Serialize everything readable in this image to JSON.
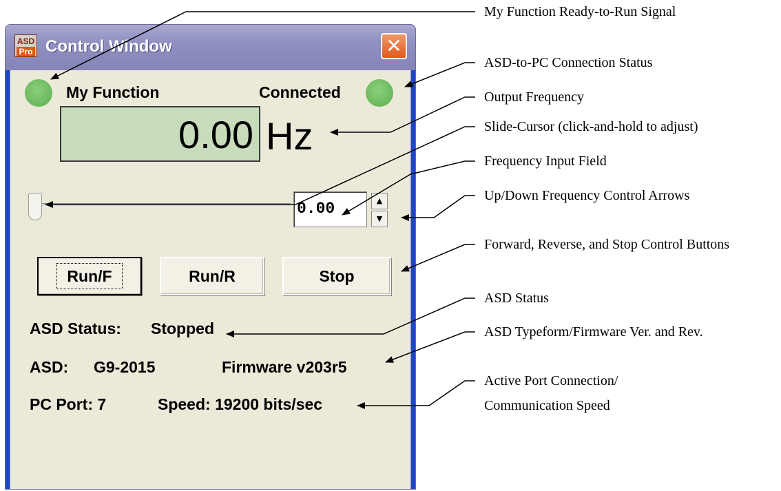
{
  "window": {
    "title": "Control Window",
    "app_icon_text": [
      "ASD",
      "Pro"
    ],
    "close_glyph": "✕"
  },
  "indicators": {
    "my_function_label": "My Function",
    "connected_label": "Connected",
    "led_color": "#6ab85c"
  },
  "frequency": {
    "display_value": "0.00",
    "unit": "Hz",
    "input_value": "0.00",
    "slider_value": 0.0
  },
  "buttons": {
    "run_forward": "Run/F",
    "run_reverse": "Run/R",
    "stop": "Stop"
  },
  "status": {
    "asd_status_label": "ASD Status:",
    "asd_status_value": "Stopped",
    "asd_label": "ASD:",
    "asd_value": "G9-2015",
    "firmware": "Firmware v203r5",
    "pc_port": "PC Port: 7",
    "speed": "Speed: 19200 bits/sec"
  },
  "icons": {
    "close": "close-icon",
    "spin_up": "arrow-up-icon",
    "spin_down": "arrow-down-icon"
  },
  "callouts": {
    "ready_signal": "My Function Ready-to-Run Signal",
    "connection_status": "ASD-to-PC Connection Status",
    "output_frequency": "Output Frequency",
    "slide_cursor": "Slide-Cursor (click-and-hold to adjust)",
    "frequency_input": "Frequency Input Field",
    "updown_arrows": "Up/Down Frequency Control Arrows",
    "control_buttons": "Forward, Reverse, and Stop Control Buttons",
    "asd_status": "ASD Status",
    "typeform": "ASD Typeform/Firmware Ver. and Rev.",
    "port_line1": "Active Port Connection/",
    "port_line2": "Communication Speed"
  }
}
